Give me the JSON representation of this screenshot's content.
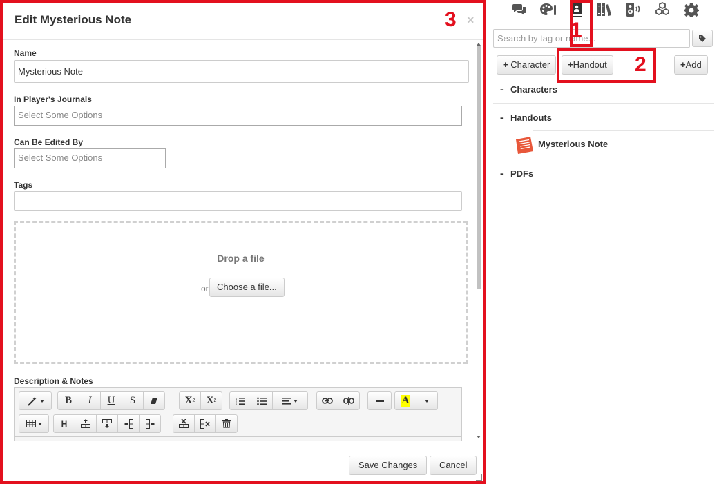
{
  "modal": {
    "title": "Edit Mysterious Note",
    "close_glyph": "×",
    "fields": {
      "name_label": "Name",
      "name_value": "Mysterious Note",
      "journals_label": "In Player's Journals",
      "journals_placeholder": "Select Some Options",
      "edited_label": "Can Be Edited By",
      "edited_placeholder": "Select Some Options",
      "tags_label": "Tags",
      "tags_value": ""
    },
    "dropzone": {
      "title": "Drop a file",
      "or_text": "or",
      "choose_label": "Choose a file..."
    },
    "description_label": "Description & Notes",
    "toolbar": {
      "row1": [
        [
          "magic-wand-icon"
        ],
        [
          "bold-button",
          "italic-button",
          "underline-button",
          "strikethrough-button",
          "eraser-icon"
        ],
        [
          "superscript-button",
          "subscript-button"
        ],
        [
          "ordered-list-icon",
          "unordered-list-icon",
          "align-icon"
        ],
        [
          "link-icon",
          "unlink-icon"
        ],
        [
          "horizontal-rule-icon"
        ],
        [
          "highlight-color-button",
          "color-dropdown-button"
        ]
      ],
      "row2": [
        [
          "table-icon"
        ],
        [
          "table-header-button",
          "insert-row-above-icon",
          "insert-row-below-icon",
          "insert-col-left-icon",
          "insert-col-right-icon"
        ],
        [
          "delete-row-icon",
          "delete-col-icon",
          "delete-table-icon"
        ]
      ],
      "labels": {
        "bold": "B",
        "italic": "I",
        "underline": "U",
        "strike": "S",
        "superscript": "X",
        "subscript": "X",
        "highlight": "A",
        "header": "H"
      }
    },
    "footer": {
      "save_label": "Save Changes",
      "cancel_label": "Cancel"
    }
  },
  "annotations": {
    "label_1": "1",
    "label_2": "2",
    "label_3": "3",
    "color": "#e3101e"
  },
  "sidebar": {
    "tabs": [
      "chat-icon",
      "art-library-icon",
      "journal-icon",
      "compendium-icon",
      "jukebox-icon",
      "collections-icon",
      "settings-icon"
    ],
    "active_tab": "journal-icon",
    "search_placeholder": "Search by tag or name...",
    "buttons": {
      "character": "Character",
      "handout": "Handout",
      "add": "Add",
      "plus": "+"
    },
    "folders": [
      {
        "dash": "-",
        "label": "Characters",
        "items": []
      },
      {
        "dash": "-",
        "label": "Handouts",
        "items": [
          {
            "label": "Mysterious Note",
            "icon": "handout-icon"
          }
        ]
      },
      {
        "dash": "-",
        "label": "PDFs",
        "items": []
      }
    ]
  },
  "colors": {
    "handout_icon": "#e8573a",
    "icon_gray": "#555555"
  }
}
